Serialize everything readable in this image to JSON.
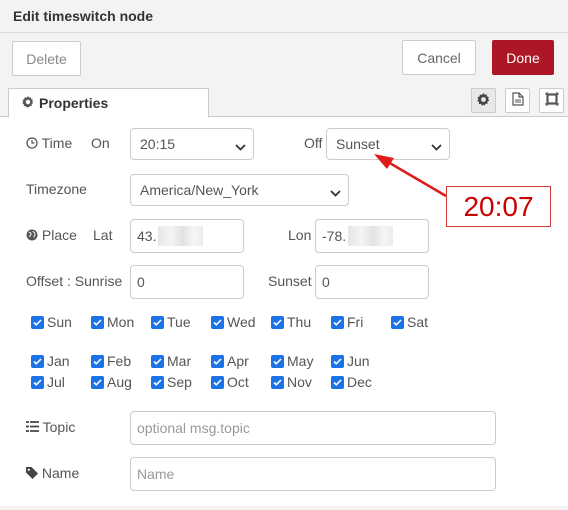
{
  "dialog": {
    "title": "Edit timeswitch node"
  },
  "actions": {
    "delete": "Delete",
    "cancel": "Cancel",
    "done": "Done"
  },
  "tabs": {
    "properties": "Properties",
    "icons": [
      "gear-icon",
      "file-text-icon",
      "frame-icon"
    ]
  },
  "form": {
    "time_label": "Time",
    "on_label": "On",
    "on_value": "20:15",
    "off_label": "Off",
    "off_value": "Sunset",
    "timezone_label": "Timezone",
    "timezone_value": "America/New_York",
    "place_label": "Place",
    "lat_label": "Lat",
    "lat_value": "43.",
    "lon_label": "Lon",
    "lon_value": "-78.",
    "offset_label": "Offset : Sunrise",
    "offset_sunrise_value": "0",
    "sunset_label": "Sunset",
    "offset_sunset_value": "0",
    "days": [
      "Sun",
      "Mon",
      "Tue",
      "Wed",
      "Thu",
      "Fri",
      "Sat"
    ],
    "months": [
      "Jan",
      "Feb",
      "Mar",
      "Apr",
      "May",
      "Jun",
      "Jul",
      "Aug",
      "Sep",
      "Oct",
      "Nov",
      "Dec"
    ],
    "topic_label": "Topic",
    "topic_placeholder": "optional msg.topic",
    "name_label": "Name",
    "name_placeholder": "Name"
  },
  "annotation": {
    "text": "20:07",
    "color": "#cc0000"
  },
  "colors": {
    "done_button": "#ad1625",
    "checkbox": "#1a73e8"
  }
}
